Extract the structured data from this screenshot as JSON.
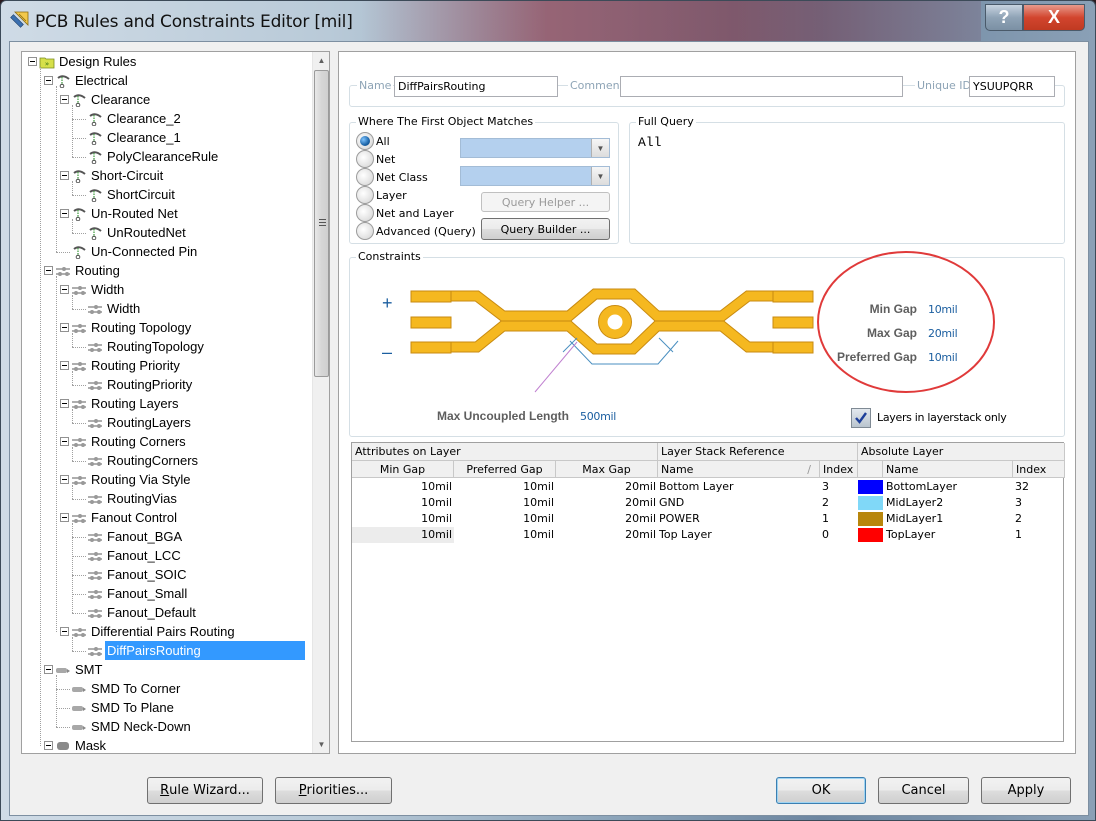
{
  "window": {
    "title": "PCB Rules and Constraints Editor [mil]",
    "help_label": "?",
    "close_label": "X"
  },
  "tree": {
    "items": [
      {
        "label": "Design Rules",
        "level": 0,
        "icon": "folder-icon",
        "expanded": true
      },
      {
        "label": "Electrical",
        "level": 1,
        "icon": "electrical-rule-icon",
        "expanded": true
      },
      {
        "label": "Clearance",
        "level": 2,
        "icon": "electrical-rule-icon",
        "expanded": true
      },
      {
        "label": "Clearance_2",
        "level": 3,
        "icon": "electrical-rule-icon"
      },
      {
        "label": "Clearance_1",
        "level": 3,
        "icon": "electrical-rule-icon"
      },
      {
        "label": "PolyClearanceRule",
        "level": 3,
        "icon": "electrical-rule-icon"
      },
      {
        "label": "Short-Circuit",
        "level": 2,
        "icon": "electrical-rule-icon",
        "expanded": true
      },
      {
        "label": "ShortCircuit",
        "level": 3,
        "icon": "electrical-rule-icon"
      },
      {
        "label": "Un-Routed Net",
        "level": 2,
        "icon": "electrical-rule-icon",
        "expanded": true
      },
      {
        "label": "UnRoutedNet",
        "level": 3,
        "icon": "electrical-rule-icon"
      },
      {
        "label": "Un-Connected Pin",
        "level": 2,
        "icon": "electrical-rule-icon"
      },
      {
        "label": "Routing",
        "level": 1,
        "icon": "routing-rule-icon",
        "expanded": true
      },
      {
        "label": "Width",
        "level": 2,
        "icon": "routing-rule-icon",
        "expanded": true
      },
      {
        "label": "Width",
        "level": 3,
        "icon": "routing-rule-icon"
      },
      {
        "label": "Routing Topology",
        "level": 2,
        "icon": "routing-rule-icon",
        "expanded": true
      },
      {
        "label": "RoutingTopology",
        "level": 3,
        "icon": "routing-rule-icon"
      },
      {
        "label": "Routing Priority",
        "level": 2,
        "icon": "routing-rule-icon",
        "expanded": true
      },
      {
        "label": "RoutingPriority",
        "level": 3,
        "icon": "routing-rule-icon"
      },
      {
        "label": "Routing Layers",
        "level": 2,
        "icon": "routing-rule-icon",
        "expanded": true
      },
      {
        "label": "RoutingLayers",
        "level": 3,
        "icon": "routing-rule-icon"
      },
      {
        "label": "Routing Corners",
        "level": 2,
        "icon": "routing-rule-icon",
        "expanded": true
      },
      {
        "label": "RoutingCorners",
        "level": 3,
        "icon": "routing-rule-icon"
      },
      {
        "label": "Routing Via Style",
        "level": 2,
        "icon": "routing-rule-icon",
        "expanded": true
      },
      {
        "label": "RoutingVias",
        "level": 3,
        "icon": "routing-rule-icon"
      },
      {
        "label": "Fanout Control",
        "level": 2,
        "icon": "routing-rule-icon",
        "expanded": true
      },
      {
        "label": "Fanout_BGA",
        "level": 3,
        "icon": "routing-rule-icon"
      },
      {
        "label": "Fanout_LCC",
        "level": 3,
        "icon": "routing-rule-icon"
      },
      {
        "label": "Fanout_SOIC",
        "level": 3,
        "icon": "routing-rule-icon"
      },
      {
        "label": "Fanout_Small",
        "level": 3,
        "icon": "routing-rule-icon"
      },
      {
        "label": "Fanout_Default",
        "level": 3,
        "icon": "routing-rule-icon"
      },
      {
        "label": "Differential Pairs Routing",
        "level": 2,
        "icon": "routing-rule-icon",
        "expanded": true
      },
      {
        "label": "DiffPairsRouting",
        "level": 3,
        "icon": "routing-rule-icon",
        "selected": true
      },
      {
        "label": "SMT",
        "level": 1,
        "icon": "smt-rule-icon",
        "expanded": true
      },
      {
        "label": "SMD To Corner",
        "level": 2,
        "icon": "smt-rule-icon"
      },
      {
        "label": "SMD To Plane",
        "level": 2,
        "icon": "smt-rule-icon"
      },
      {
        "label": "SMD Neck-Down",
        "level": 2,
        "icon": "smt-rule-icon"
      },
      {
        "label": "Mask",
        "level": 1,
        "icon": "mask-rule-icon",
        "expanded": true
      }
    ]
  },
  "rule": {
    "name_label": "Name",
    "name_value": "DiffPairsRouting",
    "comment_label": "Comment",
    "comment_value": "",
    "unique_id_label": "Unique ID",
    "unique_id_value": "YSUUPQRR"
  },
  "match": {
    "title": "Where The First Object Matches",
    "options": [
      "All",
      "Net",
      "Net Class",
      "Layer",
      "Net and Layer",
      "Advanced (Query)"
    ],
    "selected": "All",
    "query_helper_label": "Query Helper ...",
    "query_builder_label": "Query Builder ..."
  },
  "full_query": {
    "title": "Full Query",
    "text": "All"
  },
  "constraints": {
    "title": "Constraints",
    "plus_label": "+",
    "minus_label": "–",
    "max_uncoupled_length_label": "Max Uncoupled Length",
    "max_uncoupled_length_value": "500mil",
    "min_gap_label": "Min Gap",
    "min_gap_value": "10mil",
    "max_gap_label": "Max Gap",
    "max_gap_value": "20mil",
    "preferred_gap_label": "Preferred Gap",
    "preferred_gap_value": "10mil",
    "layers_in_stack_only_label": "Layers in layerstack only",
    "layers_in_stack_only_checked": true,
    "trace_color": "#f5b820",
    "highlight_color": "#e03a3a"
  },
  "layers_grid": {
    "group_headers": [
      "Attributes on Layer",
      "Layer Stack Reference",
      "Absolute Layer"
    ],
    "columns": [
      "Min Gap",
      "Preferred Gap",
      "Max Gap",
      "Name",
      "Index",
      "Name",
      "Index"
    ],
    "sort_indicator": "∕",
    "rows": [
      {
        "min_gap": "10mil",
        "preferred_gap": "10mil",
        "max_gap": "20mil",
        "stack_name": "Bottom Layer",
        "stack_index": "3",
        "abs_color": "#0000ff",
        "abs_name": "BottomLayer",
        "abs_index": "32"
      },
      {
        "min_gap": "10mil",
        "preferred_gap": "10mil",
        "max_gap": "20mil",
        "stack_name": "GND",
        "stack_index": "2",
        "abs_color": "#80d8f8",
        "abs_name": "MidLayer2",
        "abs_index": "3"
      },
      {
        "min_gap": "10mil",
        "preferred_gap": "10mil",
        "max_gap": "20mil",
        "stack_name": "POWER",
        "stack_index": "1",
        "abs_color": "#b8860b",
        "abs_name": "MidLayer1",
        "abs_index": "2"
      },
      {
        "min_gap": "10mil",
        "preferred_gap": "10mil",
        "max_gap": "20mil",
        "stack_name": "Top Layer",
        "stack_index": "0",
        "abs_color": "#ff0000",
        "abs_name": "TopLayer",
        "abs_index": "1"
      }
    ]
  },
  "footer": {
    "rule_wizard_label_mn": "R",
    "rule_wizard_label_rest": "ule Wizard...",
    "priorities_label_mn": "P",
    "priorities_label_rest": "riorities...",
    "ok_label": "OK",
    "cancel_label": "Cancel",
    "apply_label": "Apply"
  }
}
